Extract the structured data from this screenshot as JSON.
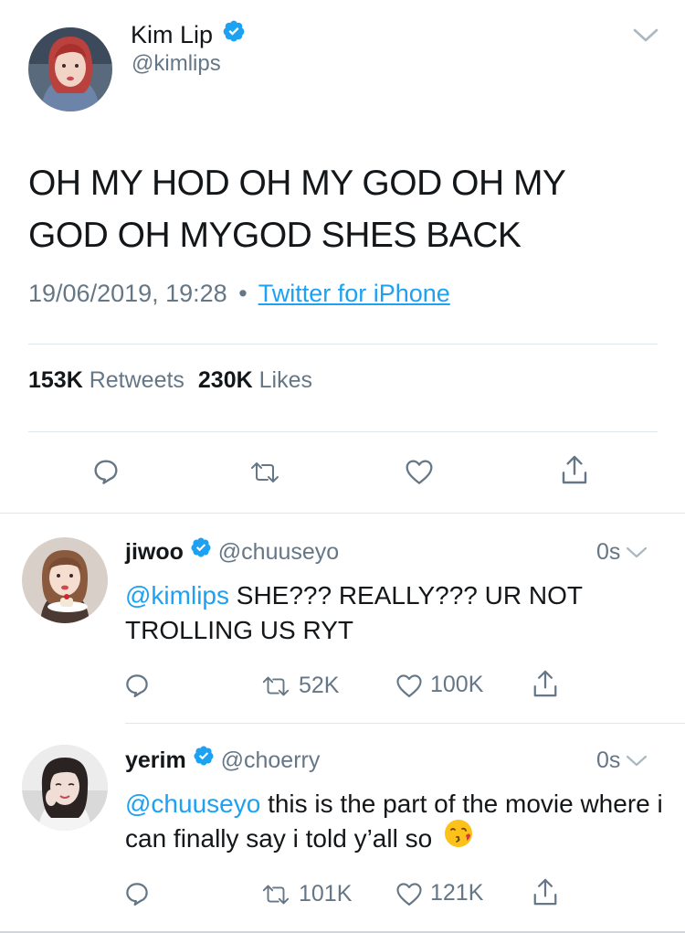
{
  "main_tweet": {
    "author_name": "Kim Lip",
    "author_handle": "@kimlips",
    "text": "OH MY HOD OH MY GOD OH MY GOD OH MYGOD SHES BACK",
    "timestamp": "19/06/2019, 19:28",
    "separator": "•",
    "source": "Twitter for iPhone",
    "retweets_count": "153K",
    "retweets_label": "Retweets",
    "likes_count": "230K",
    "likes_label": "Likes"
  },
  "replies": [
    {
      "author_name": "jiwoo",
      "author_handle": "@chuuseyo",
      "time": "0s",
      "mention": "@kimlips",
      "text": "SHE??? REALLY??? UR NOT TROLLING US RYT",
      "retweets": "52K",
      "likes": "100K"
    },
    {
      "author_name": "yerim",
      "author_handle": "@choerry",
      "time": "0s",
      "mention": "@chuuseyo",
      "text": "this is the part of the movie where i can finally say i told y’all so",
      "retweets": "101K",
      "likes": "121K"
    }
  ],
  "colors": {
    "link": "#1da1f2",
    "verified": "#1da1f2",
    "secondary_text": "#657786",
    "divider": "#e1e8ed"
  }
}
